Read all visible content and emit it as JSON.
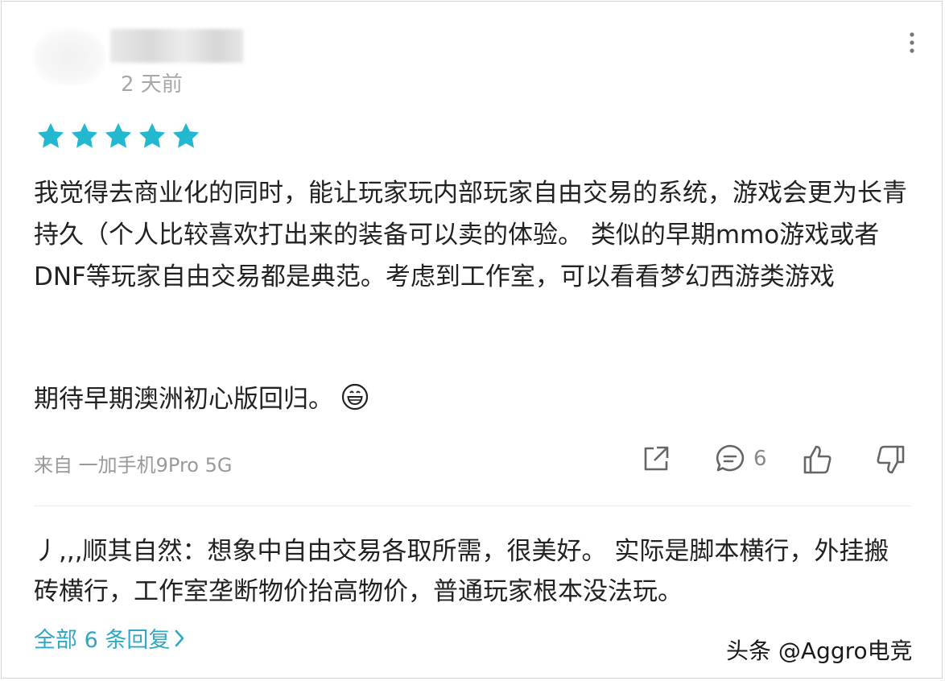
{
  "comment": {
    "time": "2 天前",
    "rating": 5,
    "accent_color": "#22b8cf",
    "text": "我觉得去商业化的同时，能让玩家玩内部玩家自由交易的系统，游戏会更为长青持久（个人比较喜欢打出来的装备可以卖的体验。 类似的早期mmo游戏或者DNF等玩家自由交易都是典范。考虑到工作室，可以看看梦幻西游类游戏",
    "text2": "期待早期澳洲初心版回归。",
    "emoji_icon": "grinning-face-emoji",
    "device": "来自 一加手机9Pro 5G",
    "comment_count": "6"
  },
  "reply": {
    "text": "丿,,,顺其自然：想象中自由交易各取所需，很美好。 实际是脚本横行，外挂搬砖横行，工作室垄断物价抬高物价，普通玩家根本没法玩。",
    "all_replies_label": "全部 6 条回复"
  },
  "watermark": "头条 @Aggro电竞"
}
